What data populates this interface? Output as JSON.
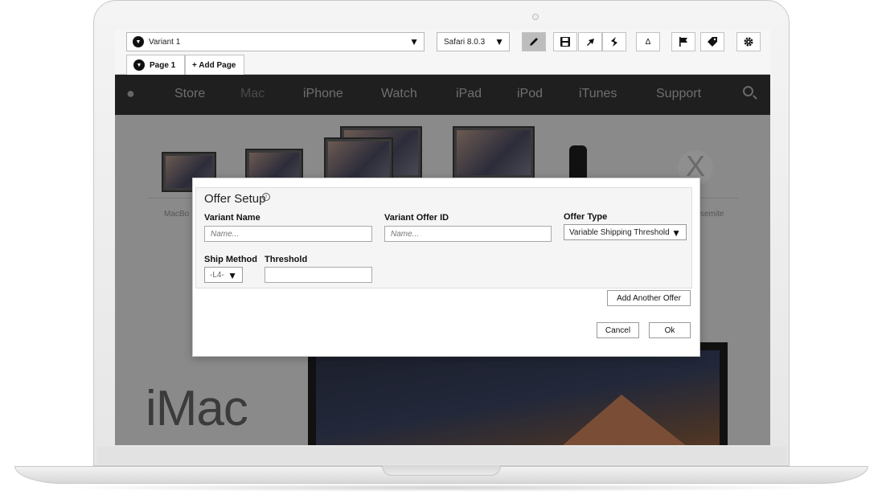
{
  "toolbar": {
    "variant_label": "Variant 1",
    "browser_label": "Safari 8.0.3",
    "delta_label": "Δ",
    "icons": [
      "pencil-icon",
      "save-icon",
      "redo-icon",
      "share-icon",
      "flag-icon",
      "tag-icon",
      "gear-icon"
    ]
  },
  "tabs": {
    "page1": "Page 1",
    "add_page": "+ Add Page"
  },
  "site": {
    "nav": [
      "Store",
      "Mac",
      "iPhone",
      "Watch",
      "iPad",
      "iPod",
      "iTunes",
      "Support"
    ],
    "product_label_left": "MacBo",
    "product_label_right": "semite",
    "hero_title": "iMac"
  },
  "modal": {
    "title": "Offer Setup",
    "variant_name_label": "Variant Name",
    "variant_name_placeholder": "Name...",
    "offer_id_label": "Variant Offer ID",
    "offer_id_placeholder": "Name...",
    "offer_type_label": "Offer Type",
    "offer_type_value": "Variable Shipping Threshold",
    "ship_method_label": "Ship Method",
    "ship_method_value": "-L4-",
    "threshold_label": "Threshold",
    "threshold_value": "",
    "add_offer_button": "Add Another Offer",
    "cancel_button": "Cancel",
    "ok_button": "Ok"
  }
}
